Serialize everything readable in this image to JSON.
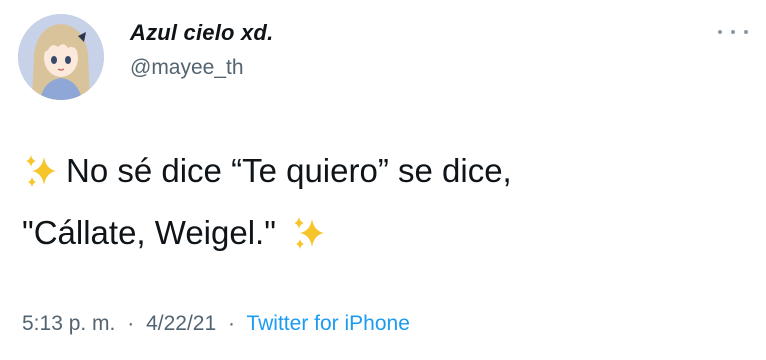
{
  "author": {
    "display_name": "Azul cielo xd.",
    "handle": "@mayee_th",
    "avatar_icon": "anime-girl-avatar"
  },
  "menu": {
    "icon": "more-icon"
  },
  "tweet": {
    "line1": "No sé dice “Te quiero” se dice,",
    "line2": "\"Cállate, Weigel.\"",
    "emoji_icon": "sparkles-icon"
  },
  "meta": {
    "time": "5:13 p. m.",
    "separator": "·",
    "date": "4/22/21",
    "source": "Twitter for iPhone"
  },
  "colors": {
    "text": "#0f1419",
    "secondary": "#536471",
    "link": "#1d9bf0",
    "sparkle": "#f5c52a"
  }
}
